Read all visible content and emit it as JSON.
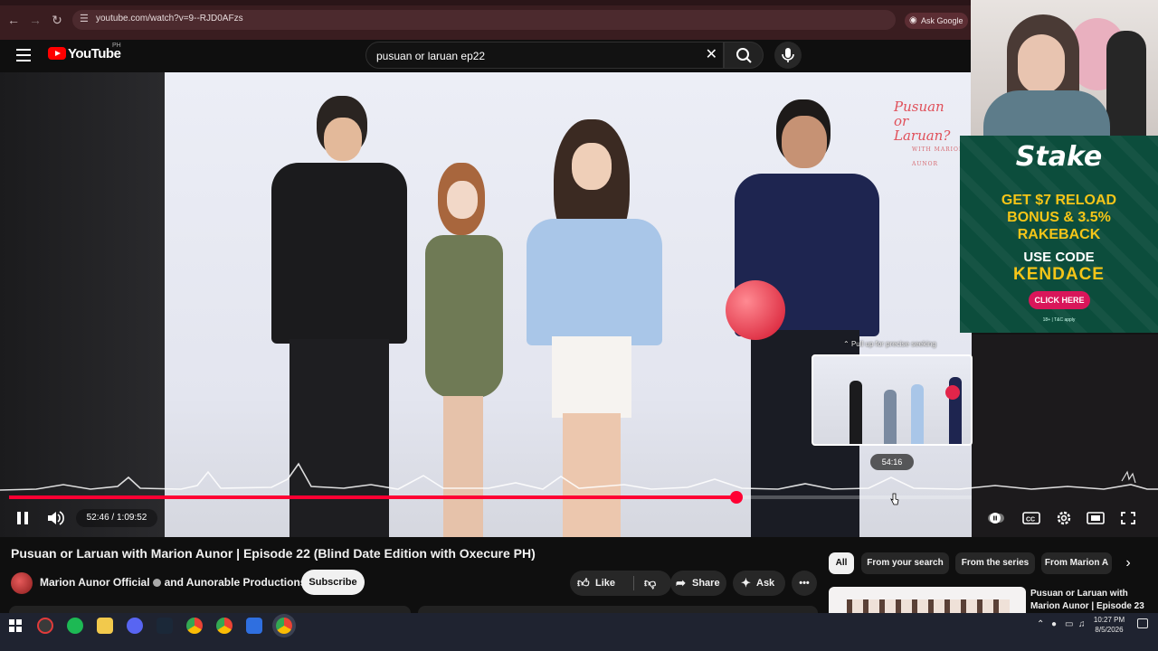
{
  "browser": {
    "url": "youtube.com/watch?v=9--RJD0AFzs",
    "ask_google": "Ask Google"
  },
  "youtube": {
    "logo_text": "YouTube",
    "country": "PH",
    "search_query": "pusuan or laruan ep22"
  },
  "player": {
    "show_logo_line1": "Pusuan",
    "show_logo_line2": "or",
    "show_logo_line3": "Laruan?",
    "show_logo_sub": "WITH MARION AUNOR",
    "pull_up_hint": "Pull up for precise seeking",
    "preview_time": "54:16",
    "current_time": "52:46",
    "duration": "1:09:52",
    "time_display": "52:46 / 1:09:52",
    "progress_fraction": 0.7552,
    "accent_color": "#ff0033"
  },
  "video": {
    "title": "Pusuan or Laruan with Marion Aunor | Episode 22 (Blind Date Edition with Oxecure PH)",
    "channel": "Marion Aunor Official",
    "channel_suffix": "and Aunorable Productions",
    "subscribe_label": "Subscribe",
    "like_label": "Like",
    "share_label": "Share",
    "ask_label": "Ask"
  },
  "related": {
    "chips": [
      "All",
      "From your search",
      "From the series",
      "From Marion A"
    ],
    "next_title": "Pusuan or Laruan with Marion Aunor | Episode 23"
  },
  "ad": {
    "brand": "Stake",
    "offer": [
      "GET $7 RELOAD",
      "BONUS & 3.5%",
      "RAKEBACK"
    ],
    "code_label": "USE CODE",
    "code": "KENDACE",
    "cta": "CLICK HERE",
    "terms": "18+ | T&C apply",
    "brand_color": "#0c4d3c",
    "accent_color": "#f5c518"
  },
  "taskbar": {
    "time": "10:27 PM",
    "date": "8/5/2026"
  }
}
